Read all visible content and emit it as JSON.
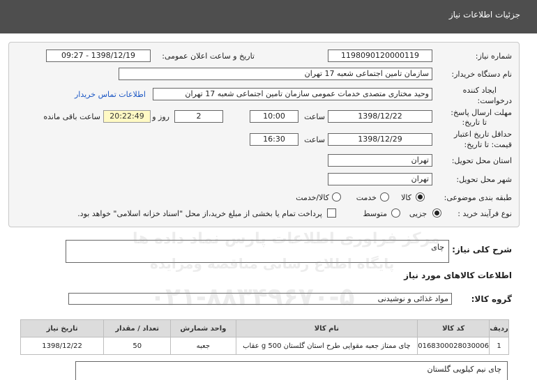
{
  "header": {
    "title": "جزئیات اطلاعات نیاز"
  },
  "form": {
    "need_number_label": "شماره نیاز:",
    "need_number": "1198090120000119",
    "announce_label": "تاریخ و ساعت اعلان عمومی:",
    "announce_value": "1398/12/19 - 09:27",
    "buyer_org_label": "نام دستگاه خریدار:",
    "buyer_org": "سازمان تامین اجتماعی شعبه 17 تهران",
    "requester_label_1": "ایجاد کننده",
    "requester_label_2": "درخواست:",
    "requester": "وحید  مختاری  متصدی خدمات عمومی  سازمان تامین اجتماعی شعبه 17 تهران",
    "contact_link": "اطلاعات تماس خریدار",
    "reply_deadline_label_1": "مهلت ارسال پاسخ:",
    "reply_deadline_label_2": "تا تاریخ:",
    "reply_date": "1398/12/22",
    "time_label": "ساعت",
    "reply_time": "10:00",
    "days_count": "2",
    "days_label": "روز و",
    "remaining_time": "20:22:49",
    "remaining_label": "ساعت باقی مانده",
    "validity_label_1": "حداقل تاریخ اعتبار",
    "validity_label_2": "قیمت: تا تاریخ:",
    "validity_date": "1398/12/29",
    "validity_time": "16:30",
    "province_label": "استان محل تحویل:",
    "province": "تهران",
    "city_label": "شهر محل تحویل:",
    "city": "تهران",
    "category_label": "طبقه بندی موضوعی:",
    "category_options": [
      "کالا",
      "خدمت",
      "کالا/خدمت"
    ],
    "category_selected": "کالا",
    "process_label": "نوع فرآیند خرید :",
    "process_options": [
      "جزیی",
      "متوسط"
    ],
    "process_selected": "جزیی",
    "payment_note": "پرداخت تمام یا بخشی از مبلغ خرید،از محل \"اسناد خزانه اسلامی\" خواهد بود."
  },
  "summary": {
    "label": "شرح کلی نیاز:",
    "value": "چای"
  },
  "goods": {
    "section_title": "اطلاعات کالاهای مورد نیاز",
    "group_label": "گروه کالا:",
    "group_value": "مواد غذائی و نوشیدنی",
    "columns": [
      "ردیف",
      "کد کالا",
      "نام کالا",
      "واحد شمارش",
      "تعداد / مقدار",
      "تاریخ نیاز"
    ],
    "rows": [
      [
        "1",
        "0168300028030006",
        "چای ممتاز جعبه مقوایی طرح استان گلستان 500 g عقاب",
        "جعبه",
        "50",
        "1398/12/22"
      ]
    ],
    "note": "چای نیم کیلویی  گلستان"
  },
  "watermark": {
    "line1": "مرکز فراوری اطلاعات پارس نماد داده ها",
    "line2": "پایگاه اطلاع رسانی مناقصه ومزایده",
    "line3": "۰۲۱-۸۸۳۴۹۶۷۰-۵"
  }
}
